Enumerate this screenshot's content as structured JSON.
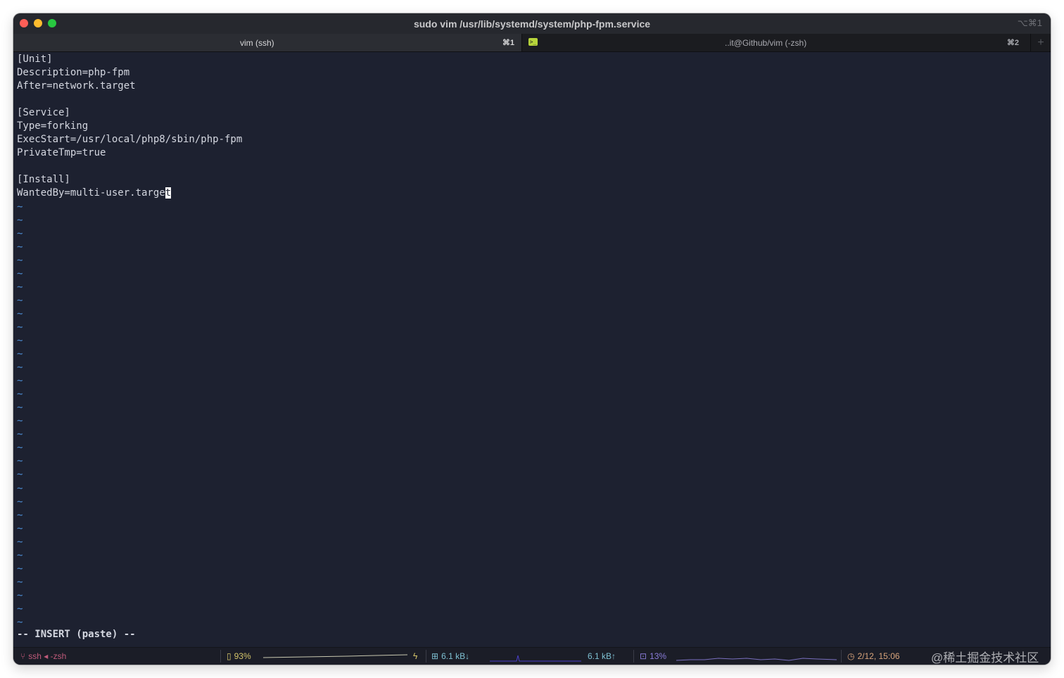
{
  "window": {
    "title": "sudo vim /usr/lib/systemd/system/php-fpm.service",
    "shortcut": "⌥⌘1"
  },
  "tabs": [
    {
      "label": "vim (ssh)",
      "shortcut": "⌘1",
      "active": true
    },
    {
      "label": "..it@Github/vim (-zsh)",
      "shortcut": "⌘2",
      "active": false,
      "icon": "terminal-icon"
    }
  ],
  "tab_add_label": "+",
  "editor": {
    "lines": [
      "[Unit]",
      "Description=php-fpm",
      "After=network.target",
      "",
      "[Service]",
      "Type=forking",
      "ExecStart=/usr/local/php8/sbin/php-fpm",
      "PrivateTmp=true",
      "",
      "[Install]"
    ],
    "cursor_line_before": "WantedBy=multi-user.targe",
    "cursor_char": "t",
    "tilde": "~",
    "tilde_count": 32,
    "mode": "-- INSERT (paste) --"
  },
  "status": {
    "ssh": "ssh ◂ -zsh",
    "battery": "93%",
    "battery_level": 0.93,
    "net_down": "6.1 kB↓",
    "net_up": "6.1 kB↑",
    "cpu": "13%",
    "cpu_level": 0.13,
    "clock": "2/12, 15:06"
  },
  "watermark": "@稀土掘金技术社区",
  "colors": {
    "background": "#1d2130",
    "tilde": "#4c8dd4",
    "text": "#d4d7e0"
  }
}
